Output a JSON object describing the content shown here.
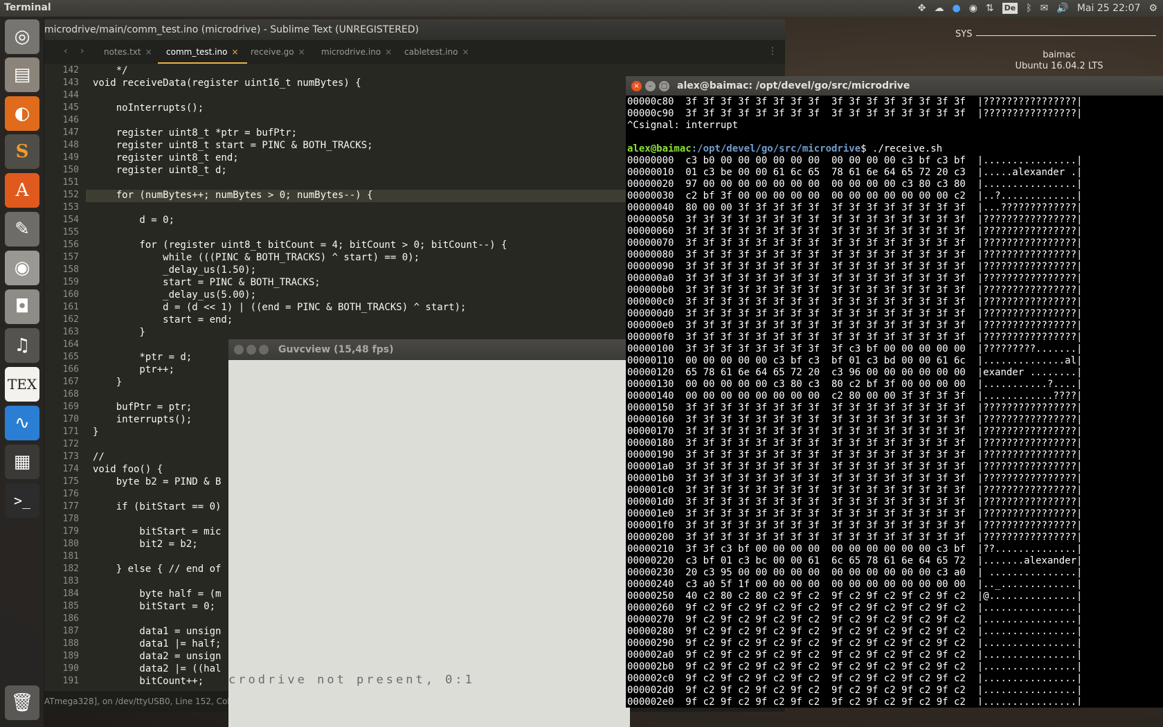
{
  "topbar": {
    "app_name": "Terminal",
    "clock": "Mai 25 22:07",
    "keyboard": "De"
  },
  "launcher": {
    "items": [
      "ubuntu-dash",
      "files",
      "firefox",
      "sublime-text",
      "software-center",
      "system-settings",
      "webcam",
      "screenshot",
      "music",
      "texmaker",
      "system-monitor",
      "calculator",
      "terminal",
      "trash"
    ]
  },
  "sysinfo": {
    "label": "SYS",
    "host": "baimac",
    "os": "Ubuntu 16.04.2 LTS"
  },
  "sublime": {
    "title": "microdrive/main/comm_test.ino (microdrive) - Sublime Text (UNREGISTERED)",
    "tabs": [
      {
        "label": "notes.txt"
      },
      {
        "label": "comm_test.ino"
      },
      {
        "label": "receive.go"
      },
      {
        "label": "microdrive.ino"
      },
      {
        "label": "cabletest.ino"
      }
    ],
    "status": "ATmega328], on /dev/ttyUSB0, Line 152, Colum",
    "lines": [
      {
        "n": "142",
        "t": "    */"
      },
      {
        "n": "143",
        "t": "void receiveData(register uint16_t numBytes) {"
      },
      {
        "n": "144",
        "t": ""
      },
      {
        "n": "145",
        "t": "    noInterrupts();"
      },
      {
        "n": "146",
        "t": ""
      },
      {
        "n": "147",
        "t": "    register uint8_t *ptr = bufPtr;"
      },
      {
        "n": "148",
        "t": "    register uint8_t start = PINC & BOTH_TRACKS;"
      },
      {
        "n": "149",
        "t": "    register uint8_t end;"
      },
      {
        "n": "150",
        "t": "    register uint8_t d;"
      },
      {
        "n": "151",
        "t": ""
      },
      {
        "n": "152",
        "t": "    for (numBytes++; numBytes > 0; numBytes--) {"
      },
      {
        "n": "153",
        "t": ""
      },
      {
        "n": "154",
        "t": "        d = 0;"
      },
      {
        "n": "155",
        "t": ""
      },
      {
        "n": "156",
        "t": "        for (register uint8_t bitCount = 4; bitCount > 0; bitCount--) {"
      },
      {
        "n": "157",
        "t": "            while (((PINC & BOTH_TRACKS) ^ start) == 0);"
      },
      {
        "n": "158",
        "t": "            _delay_us(1.50);"
      },
      {
        "n": "159",
        "t": "            start = PINC & BOTH_TRACKS;"
      },
      {
        "n": "160",
        "t": "            _delay_us(5.00);"
      },
      {
        "n": "161",
        "t": "            d = (d << 1) | ((end = PINC & BOTH_TRACKS) ^ start);"
      },
      {
        "n": "162",
        "t": "            start = end;"
      },
      {
        "n": "163",
        "t": "        }"
      },
      {
        "n": "164",
        "t": ""
      },
      {
        "n": "165",
        "t": "        *ptr = d;"
      },
      {
        "n": "166",
        "t": "        ptr++;"
      },
      {
        "n": "167",
        "t": "    }"
      },
      {
        "n": "168",
        "t": ""
      },
      {
        "n": "169",
        "t": "    bufPtr = ptr;"
      },
      {
        "n": "170",
        "t": "    interrupts();"
      },
      {
        "n": "171",
        "t": "}"
      },
      {
        "n": "172",
        "t": ""
      },
      {
        "n": "173",
        "t": "//"
      },
      {
        "n": "174",
        "t": "void foo() {"
      },
      {
        "n": "175",
        "t": "    byte b2 = PIND & B"
      },
      {
        "n": "176",
        "t": ""
      },
      {
        "n": "177",
        "t": "    if (bitStart == 0)"
      },
      {
        "n": "178",
        "t": ""
      },
      {
        "n": "179",
        "t": "        bitStart = mic"
      },
      {
        "n": "180",
        "t": "        bit2 = b2;"
      },
      {
        "n": "181",
        "t": ""
      },
      {
        "n": "182",
        "t": "    } else { // end of"
      },
      {
        "n": "183",
        "t": ""
      },
      {
        "n": "184",
        "t": "        byte half = (m"
      },
      {
        "n": "185",
        "t": "        bitStart = 0;"
      },
      {
        "n": "186",
        "t": ""
      },
      {
        "n": "187",
        "t": "        data1 = unsign"
      },
      {
        "n": "188",
        "t": "        data1 |= half;"
      },
      {
        "n": "189",
        "t": "        data2 = unsign"
      },
      {
        "n": "190",
        "t": "        data2 |= ((hal"
      },
      {
        "n": "191",
        "t": "        bitCount++;"
      }
    ]
  },
  "guvcview": {
    "title": "Guvcview  (15,48 fps)",
    "screen_text": "crodrive not present, 0:1"
  },
  "terminal": {
    "title": "alex@baimac: /opt/devel/go/src/microdrive",
    "prompt_user": "alex@baimac",
    "prompt_path": ":/opt/devel/go/src/microdrive",
    "command": "$ ./receive.sh",
    "pre_lines": [
      "00000c80  3f 3f 3f 3f 3f 3f 3f 3f  3f 3f 3f 3f 3f 3f 3f 3f  |????????????????|",
      "00000c90  3f 3f 3f 3f 3f 3f 3f 3f  3f 3f 3f 3f 3f 3f 3f 3f  |????????????????|",
      "^Csignal: interrupt",
      ""
    ],
    "post_lines": [
      "00000000  c3 b0 00 00 00 00 00 00  00 00 00 00 c3 bf c3 bf  |................|",
      "00000010  01 c3 be 00 00 61 6c 65  78 61 6e 64 65 72 20 c3  |.....alexander .|",
      "00000020  97 00 00 00 00 00 00 00  00 00 00 00 c3 80 c3 80  |................|",
      "00000030  c2 bf 3f 00 00 00 00 00  00 00 00 00 00 00 00 c2  |..?.............|",
      "00000040  80 00 00 3f 3f 3f 3f 3f  3f 3f 3f 3f 3f 3f 3f 3f  |...?????????????|",
      "00000050  3f 3f 3f 3f 3f 3f 3f 3f  3f 3f 3f 3f 3f 3f 3f 3f  |????????????????|",
      "00000060  3f 3f 3f 3f 3f 3f 3f 3f  3f 3f 3f 3f 3f 3f 3f 3f  |????????????????|",
      "00000070  3f 3f 3f 3f 3f 3f 3f 3f  3f 3f 3f 3f 3f 3f 3f 3f  |????????????????|",
      "00000080  3f 3f 3f 3f 3f 3f 3f 3f  3f 3f 3f 3f 3f 3f 3f 3f  |????????????????|",
      "00000090  3f 3f 3f 3f 3f 3f 3f 3f  3f 3f 3f 3f 3f 3f 3f 3f  |????????????????|",
      "000000a0  3f 3f 3f 3f 3f 3f 3f 3f  3f 3f 3f 3f 3f 3f 3f 3f  |????????????????|",
      "000000b0  3f 3f 3f 3f 3f 3f 3f 3f  3f 3f 3f 3f 3f 3f 3f 3f  |????????????????|",
      "000000c0  3f 3f 3f 3f 3f 3f 3f 3f  3f 3f 3f 3f 3f 3f 3f 3f  |????????????????|",
      "000000d0  3f 3f 3f 3f 3f 3f 3f 3f  3f 3f 3f 3f 3f 3f 3f 3f  |????????????????|",
      "000000e0  3f 3f 3f 3f 3f 3f 3f 3f  3f 3f 3f 3f 3f 3f 3f 3f  |????????????????|",
      "000000f0  3f 3f 3f 3f 3f 3f 3f 3f  3f 3f 3f 3f 3f 3f 3f 3f  |????????????????|",
      "00000100  3f 3f 3f 3f 3f 3f 3f 3f  3f c3 bf 00 00 00 00 00  |?????????.......|",
      "00000110  00 00 00 00 00 c3 bf c3  bf 01 c3 bd 00 00 61 6c  |..............al|",
      "00000120  65 78 61 6e 64 65 72 20  c3 96 00 00 00 00 00 00  |exander ........|",
      "00000130  00 00 00 00 00 c3 80 c3  80 c2 bf 3f 00 00 00 00  |...........?....|",
      "00000140  00 00 00 00 00 00 00 00  c2 80 00 00 3f 3f 3f 3f  |............????|",
      "00000150  3f 3f 3f 3f 3f 3f 3f 3f  3f 3f 3f 3f 3f 3f 3f 3f  |????????????????|",
      "00000160  3f 3f 3f 3f 3f 3f 3f 3f  3f 3f 3f 3f 3f 3f 3f 3f  |????????????????|",
      "00000170  3f 3f 3f 3f 3f 3f 3f 3f  3f 3f 3f 3f 3f 3f 3f 3f  |????????????????|",
      "00000180  3f 3f 3f 3f 3f 3f 3f 3f  3f 3f 3f 3f 3f 3f 3f 3f  |????????????????|",
      "00000190  3f 3f 3f 3f 3f 3f 3f 3f  3f 3f 3f 3f 3f 3f 3f 3f  |????????????????|",
      "000001a0  3f 3f 3f 3f 3f 3f 3f 3f  3f 3f 3f 3f 3f 3f 3f 3f  |????????????????|",
      "000001b0  3f 3f 3f 3f 3f 3f 3f 3f  3f 3f 3f 3f 3f 3f 3f 3f  |????????????????|",
      "000001c0  3f 3f 3f 3f 3f 3f 3f 3f  3f 3f 3f 3f 3f 3f 3f 3f  |????????????????|",
      "000001d0  3f 3f 3f 3f 3f 3f 3f 3f  3f 3f 3f 3f 3f 3f 3f 3f  |????????????????|",
      "000001e0  3f 3f 3f 3f 3f 3f 3f 3f  3f 3f 3f 3f 3f 3f 3f 3f  |????????????????|",
      "000001f0  3f 3f 3f 3f 3f 3f 3f 3f  3f 3f 3f 3f 3f 3f 3f 3f  |????????????????|",
      "00000200  3f 3f 3f 3f 3f 3f 3f 3f  3f 3f 3f 3f 3f 3f 3f 3f  |????????????????|",
      "00000210  3f 3f c3 bf 00 00 00 00  00 00 00 00 00 00 c3 bf  |??..............|",
      "00000220  c3 bf 01 c3 bc 00 00 61  6c 65 78 61 6e 64 65 72  |.......alexander|",
      "00000230  20 c3 95 00 00 00 00 00  00 00 00 00 00 00 c3 a0  | ...............|",
      "00000240  c3 a0 5f 1f 00 00 00 00  00 00 00 00 00 00 00 00  |.._.............|",
      "00000250  40 c2 80 c2 80 c2 9f c2  9f c2 9f c2 9f c2 9f c2  |@...............|",
      "00000260  9f c2 9f c2 9f c2 9f c2  9f c2 9f c2 9f c2 9f c2  |................|",
      "00000270  9f c2 9f c2 9f c2 9f c2  9f c2 9f c2 9f c2 9f c2  |................|",
      "00000280  9f c2 9f c2 9f c2 9f c2  9f c2 9f c2 9f c2 9f c2  |................|",
      "00000290  9f c2 9f c2 9f c2 9f c2  9f c2 9f c2 9f c2 9f c2  |................|",
      "000002a0  9f c2 9f c2 9f c2 9f c2  9f c2 9f c2 9f c2 9f c2  |................|",
      "000002b0  9f c2 9f c2 9f c2 9f c2  9f c2 9f c2 9f c2 9f c2  |................|",
      "000002c0  9f c2 9f c2 9f c2 9f c2  9f c2 9f c2 9f c2 9f c2  |................|",
      "000002d0  9f c2 9f c2 9f c2 9f c2  9f c2 9f c2 9f c2 9f c2  |................|",
      "000002e0  9f c2 9f c2 9f c2 9f c2  9f c2 9f c2 9f c2 9f c2  |................|"
    ]
  }
}
